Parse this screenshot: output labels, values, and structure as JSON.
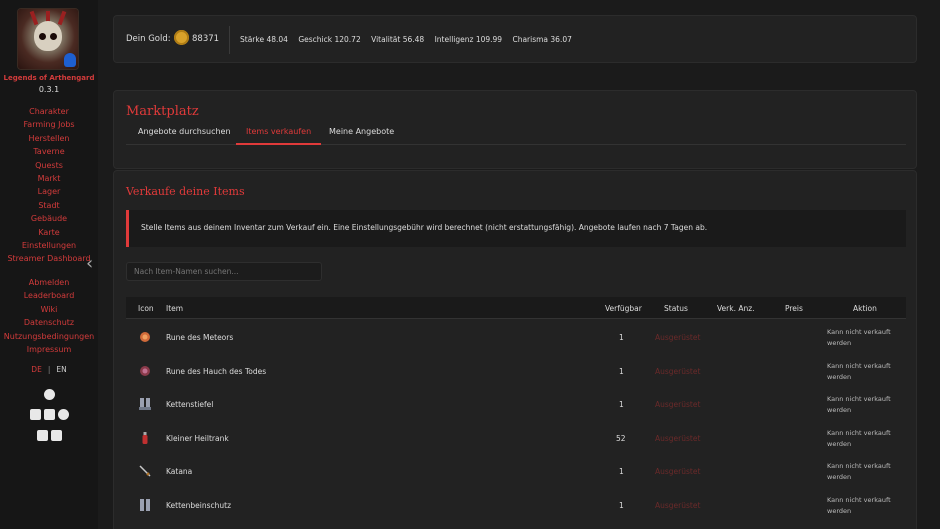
{
  "app": {
    "name": "Legends of Arthengard",
    "version": "0.3.1"
  },
  "nav_main": [
    "Charakter",
    "Farming Jobs",
    "Herstellen",
    "Taverne",
    "Quests",
    "Markt",
    "Lager",
    "Stadt",
    "Gebäude",
    "Karte",
    "Einstellungen",
    "Streamer Dashboard"
  ],
  "nav_secondary": [
    "Abmelden",
    "Leaderboard",
    "Wiki",
    "Datenschutz",
    "Nutzungsbedingungen",
    "Impressum"
  ],
  "lang": {
    "de": "DE",
    "sep": "|",
    "en": "EN"
  },
  "stats": {
    "gold_label": "Dein Gold:",
    "gold_value": "88371",
    "strength": "Stärke 48.04",
    "dexterity": "Geschick 120.72",
    "vitality": "Vitalität 56.48",
    "intelligence": "Intelligenz 109.99",
    "charisma": "Charisma 36.07"
  },
  "market": {
    "title": "Marktplatz",
    "tabs": [
      "Angebote durchsuchen",
      "Items verkaufen",
      "Meine Angebote"
    ],
    "active_tab": "Items verkaufen"
  },
  "sell": {
    "title": "Verkaufe deine Items",
    "info": "Stelle Items aus deinem Inventar zum Verkauf ein. Eine Einstellungsgebühr wird berechnet (nicht erstattungsfähig). Angebote laufen nach 7 Tagen ab.",
    "search_placeholder": "Nach Item-Namen suchen...",
    "columns": {
      "icon": "Icon",
      "item": "Item",
      "available": "Verfügbar",
      "status": "Status",
      "sell_qty": "Verk. Anz.",
      "price": "Preis",
      "action": "Aktion"
    },
    "rows": [
      {
        "icon": "rune-icon",
        "name": "Rune des Meteors",
        "available": "1",
        "status": "Ausgerüstet",
        "action": "Kann nicht verkauft werden"
      },
      {
        "icon": "rune-icon",
        "name": "Rune des Hauch des Todes",
        "available": "1",
        "status": "Ausgerüstet",
        "action": "Kann nicht verkauft werden"
      },
      {
        "icon": "boots-icon",
        "name": "Kettenstiefel",
        "available": "1",
        "status": "Ausgerüstet",
        "action": "Kann nicht verkauft werden"
      },
      {
        "icon": "potion-icon",
        "name": "Kleiner Heiltrank",
        "available": "52",
        "status": "Ausgerüstet",
        "action": "Kann nicht verkauft werden"
      },
      {
        "icon": "sword-icon",
        "name": "Katana",
        "available": "1",
        "status": "Ausgerüstet",
        "action": "Kann nicht verkauft werden"
      },
      {
        "icon": "leg-armor-icon",
        "name": "Kettenbeinschutz",
        "available": "1",
        "status": "Ausgerüstet",
        "action": "Kann nicht verkauft werden"
      }
    ]
  },
  "colors": {
    "accent": "#e03a3a",
    "background": "#1b1b1b",
    "panel": "#222222",
    "gold": "#d9a22a"
  }
}
